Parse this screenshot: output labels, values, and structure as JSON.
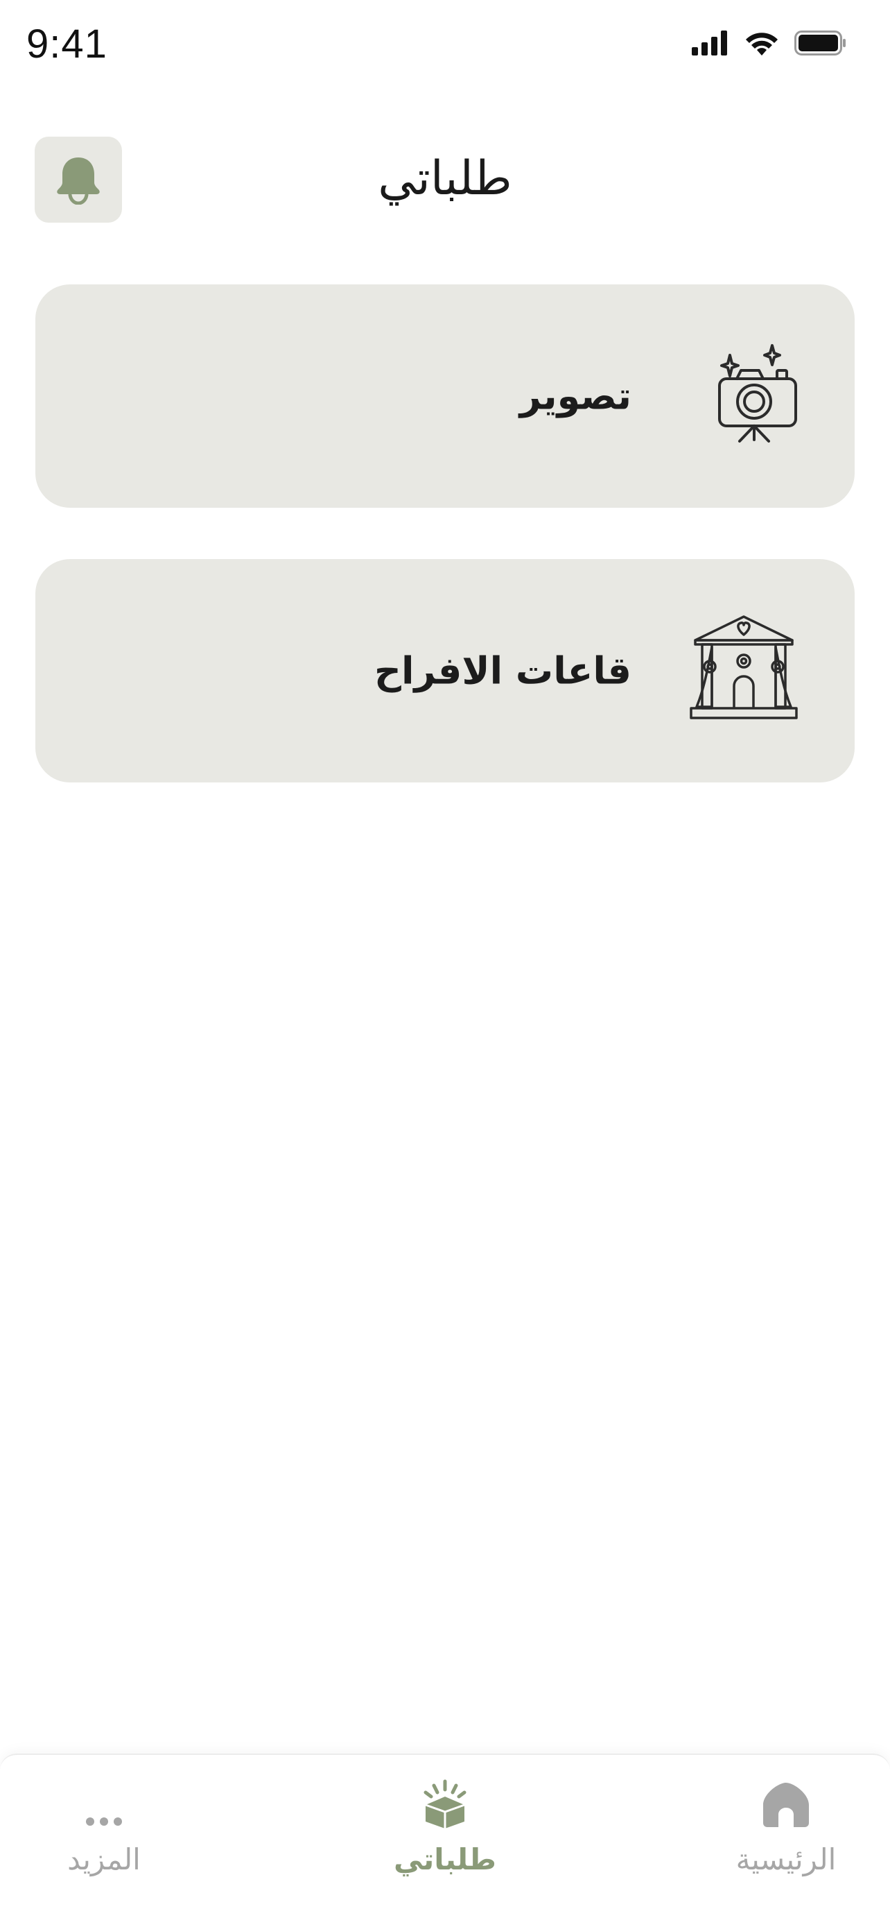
{
  "status_bar": {
    "time": "9:41"
  },
  "header": {
    "title": "طلباتي"
  },
  "categories": [
    {
      "label": "تصوير",
      "icon": "camera-icon"
    },
    {
      "label": "قاعات الافراح",
      "icon": "wedding-hall-icon"
    }
  ],
  "tab_bar": {
    "tabs": [
      {
        "label": "المزيد",
        "icon": "more-dots-icon",
        "active": false
      },
      {
        "label": "طلباتي",
        "icon": "orders-box-icon",
        "active": true
      },
      {
        "label": "الرئيسية",
        "icon": "home-icon",
        "active": false
      }
    ]
  },
  "colors": {
    "accent": "#8a9a78",
    "card_background": "#e8e8e3",
    "inactive_tab": "#a6a6a6"
  }
}
